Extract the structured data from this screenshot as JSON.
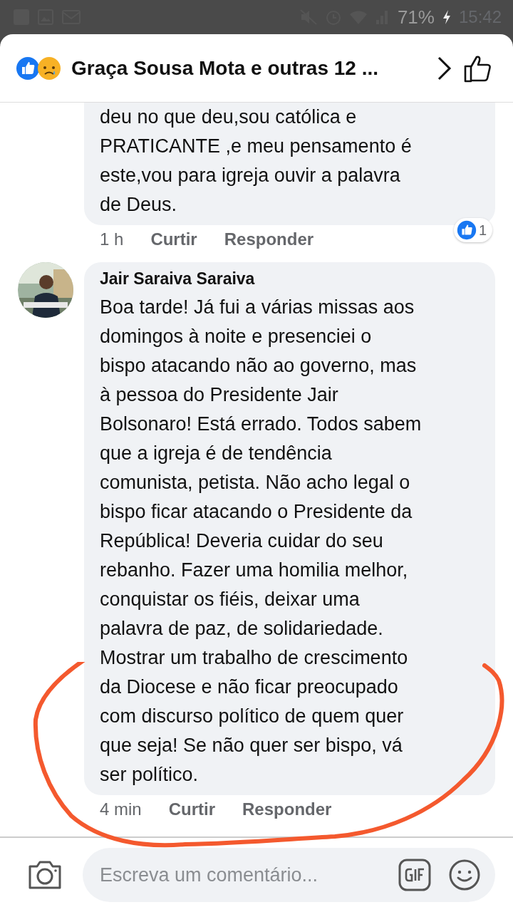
{
  "status_bar": {
    "battery": "71%",
    "time": "15:42"
  },
  "header": {
    "title": "Graça Sousa Mota e outras 12 ..."
  },
  "comments": [
    {
      "text": "deu no que deu,sou católica e\nPRATICANTE ,e meu pensamento é\neste,vou para igreja ouvir a palavra\nde Deus.",
      "time": "1 h",
      "actions": [
        "Curtir",
        "Responder"
      ],
      "reaction_count": "1",
      "has_avatar": false
    },
    {
      "author": "Jair Saraiva Saraiva",
      "text": "Boa tarde! Já fui a várias missas aos\ndomingos à noite e presenciei o\nbispo atacando não ao governo, mas\nà pessoa do Presidente Jair\nBolsonaro! Está errado. Todos sabem\nque a igreja é de tendência\ncomunista, petista. Não acho legal o\nbispo ficar atacando o Presidente da\nRepública! Deveria cuidar do seu\nrebanho. Fazer uma homilia melhor,\nconquistar os fiéis, deixar uma\npalavra de paz, de solidariedade.\nMostrar um trabalho de crescimento\nda Diocese e não ficar preocupado\ncom discurso político de quem quer\nque seja! Se não quer ser bispo, vá\nser político.",
      "time": "4 min",
      "actions": [
        "Curtir",
        "Responder"
      ],
      "has_avatar": true
    }
  ],
  "composer": {
    "placeholder": "Escreva um comentário..."
  }
}
